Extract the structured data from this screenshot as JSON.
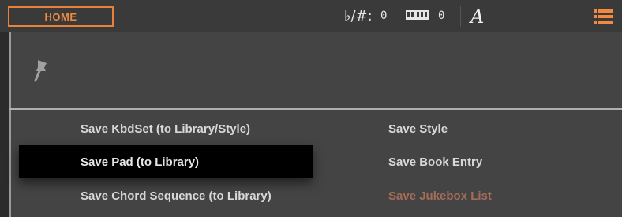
{
  "header": {
    "home_tab": "HOME",
    "transpose_icon": "flat-sharp-icon",
    "transpose_value": "0",
    "keyboard_icon": "keyboard-icon",
    "keyboard_value": "0",
    "chord_icon": "A",
    "menu_icon": "list-menu-icon",
    "accent_color": "#f08a40"
  },
  "panel": {
    "pin_icon": "pin-icon"
  },
  "menu": {
    "left": [
      {
        "label": "Save KbdSet (to Library/Style)"
      },
      {
        "label": "Save Pad (to Library)",
        "selected": true
      },
      {
        "label": "Save Chord Sequence (to Library)"
      }
    ],
    "right": [
      {
        "label": "Save Style"
      },
      {
        "label": "Save Book Entry"
      },
      {
        "label": "Save Jukebox List",
        "disabled": true
      }
    ]
  }
}
